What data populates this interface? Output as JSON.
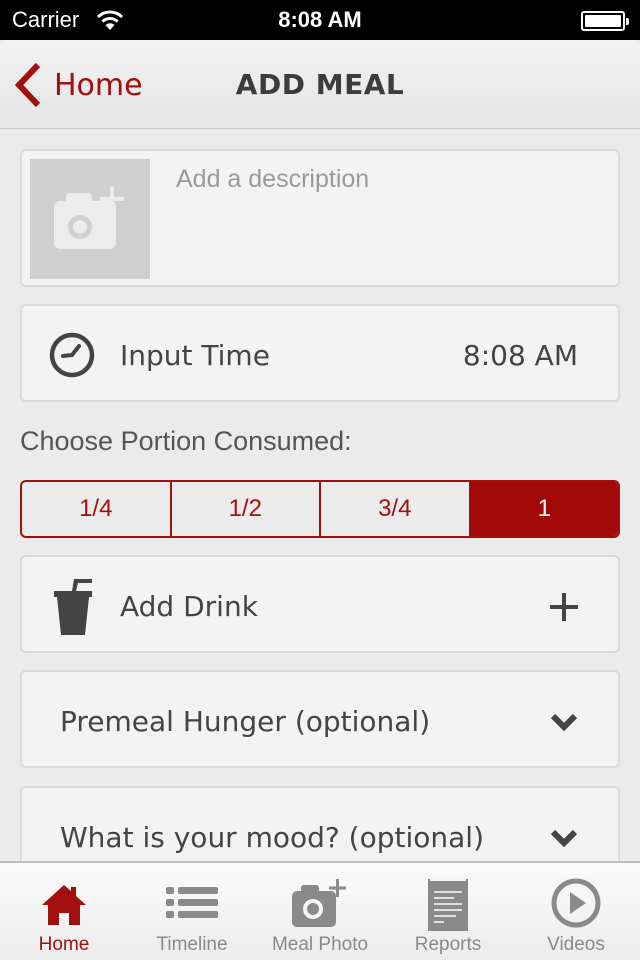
{
  "status_bar": {
    "carrier": "Carrier",
    "time": "8:08 AM",
    "icons": [
      "wifi-icon",
      "battery-icon"
    ]
  },
  "nav": {
    "back_label": "Home",
    "back_icon": "chevron-left-icon",
    "title": "ADD MEAL"
  },
  "meal": {
    "photo_icon": "camera-add-icon",
    "description_value": "",
    "description_placeholder": "Add a description",
    "time_label": "Input Time",
    "time_value": "8:08 AM",
    "time_icon": "clock-icon"
  },
  "portion": {
    "label": "Choose Portion Consumed:",
    "options": [
      "1/4",
      "1/2",
      "3/4",
      "1"
    ],
    "selected": "1"
  },
  "drink": {
    "label": "Add Drink",
    "icon": "cup-icon",
    "action_icon": "plus-icon"
  },
  "dropdowns": {
    "hunger": "Premeal Hunger (optional)",
    "mood": "What is your mood? (optional)"
  },
  "tabs": [
    {
      "label": "Home",
      "icon": "home-icon",
      "active": true
    },
    {
      "label": "Timeline",
      "icon": "list-icon",
      "active": false
    },
    {
      "label": "Meal Photo",
      "icon": "camera-add-icon",
      "active": false
    },
    {
      "label": "Reports",
      "icon": "report-icon",
      "active": false
    },
    {
      "label": "Videos",
      "icon": "play-circle-icon",
      "active": false
    }
  ],
  "colors": {
    "accent": "#a30f0f",
    "text": "#444444",
    "inactive_tab": "#8a8a8a",
    "card_bg": "#f3f3f3",
    "page_bg": "#ebebeb"
  }
}
